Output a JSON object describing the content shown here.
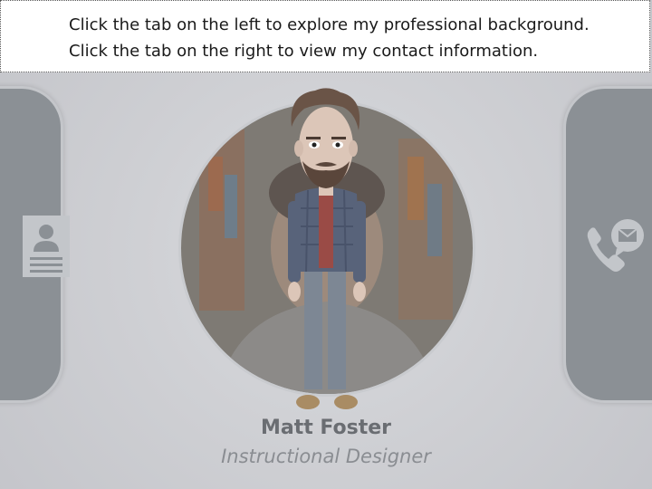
{
  "instructions": {
    "line1": "Click the tab on the left to explore my professional background.",
    "line2": "Click the tab on the right to view my contact information."
  },
  "tabs": {
    "left": {
      "icon": "resume-card-icon"
    },
    "right": {
      "icon": "phone-mail-icon"
    }
  },
  "profile": {
    "name": "Matt Foster",
    "title": "Instructional Designer"
  },
  "colors": {
    "tab_fill": "#8b9095",
    "background": "#cfd0d4",
    "name_text": "#6a6d72"
  }
}
